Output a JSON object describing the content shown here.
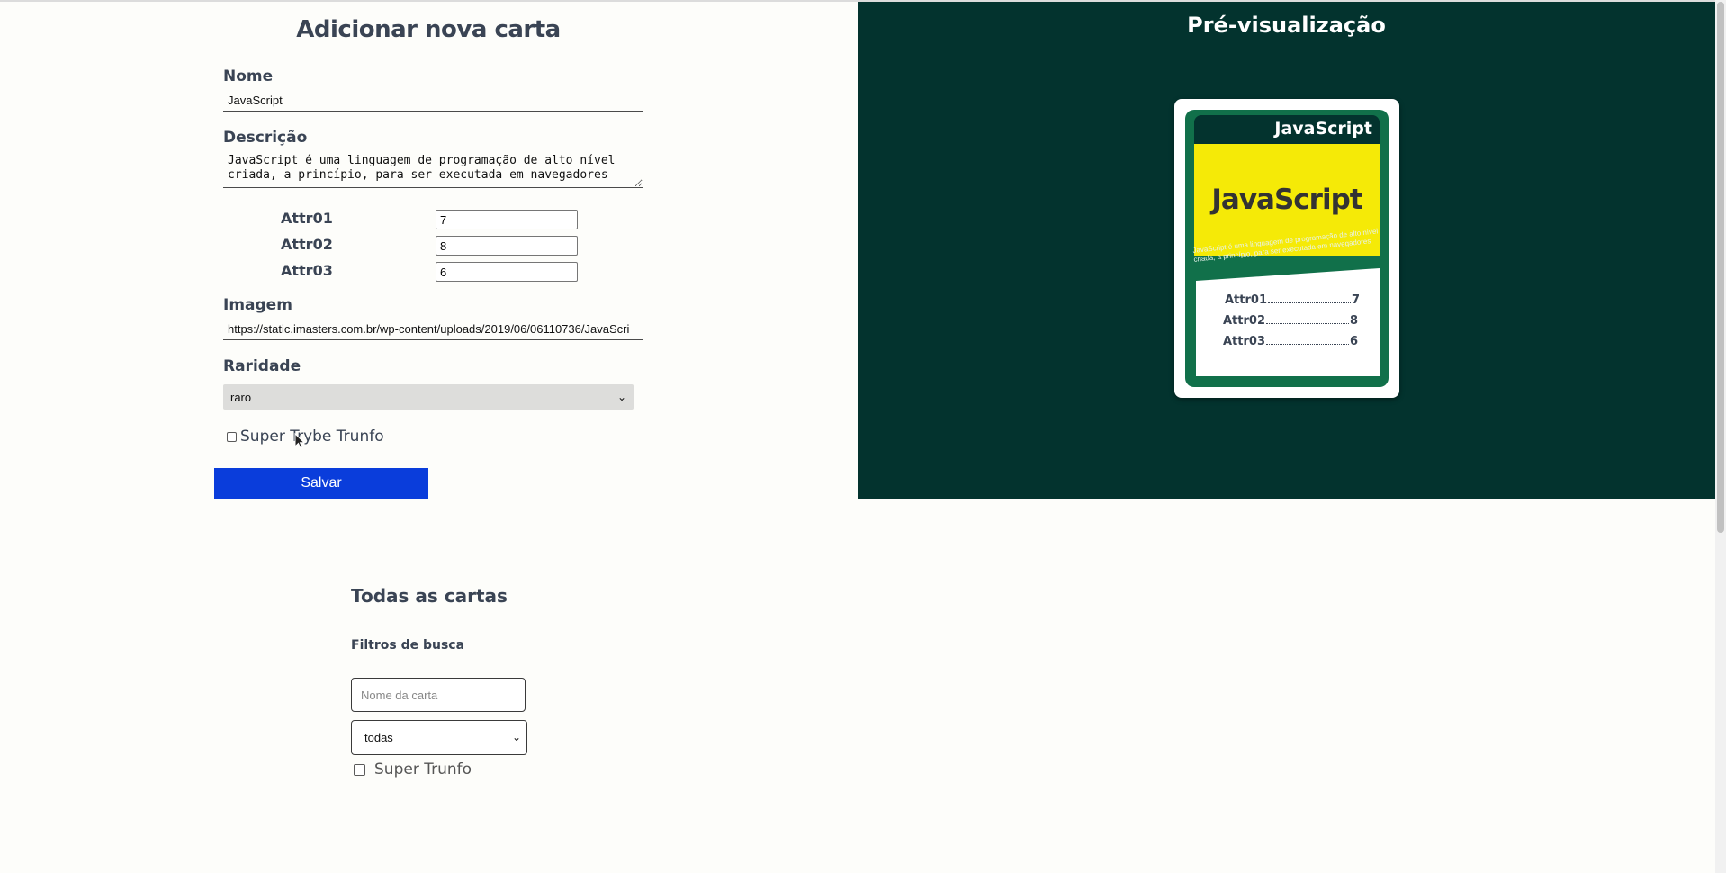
{
  "form": {
    "title": "Adicionar nova carta",
    "name_label": "Nome",
    "name_value": "JavaScript",
    "description_label": "Descrição",
    "description_value": "JavaScript é uma linguagem de programação de alto nível criada, a princípio, para ser executada em navegadores",
    "attrs": [
      {
        "label": "Attr01",
        "value": "7"
      },
      {
        "label": "Attr02",
        "value": "8"
      },
      {
        "label": "Attr03",
        "value": "6"
      }
    ],
    "image_label": "Imagem",
    "image_value": "https://static.imasters.com.br/wp-content/uploads/2019/06/06110736/JavaScri",
    "rarity_label": "Raridade",
    "rarity_value": "raro",
    "trunfo_label": "Super Trybe Trunfo",
    "save_label": "Salvar"
  },
  "preview": {
    "title": "Pré-visualização",
    "card": {
      "name": "JavaScript",
      "image_text": "JavaScript",
      "description": "JavaScript é uma linguagem de programação de alto nível criada, a princípio, para ser executada em navegadores",
      "attrs": [
        {
          "label": "Attr01",
          "value": "7"
        },
        {
          "label": "Attr02",
          "value": "8"
        },
        {
          "label": "Attr03",
          "value": "6"
        }
      ]
    }
  },
  "listing": {
    "title": "Todas as cartas",
    "filters_title": "Filtros de busca",
    "name_placeholder": "Nome da carta",
    "rarity_value": "todas",
    "trunfo_label": "Super Trunfo"
  },
  "colors": {
    "preview_bg": "#03332e",
    "card_green": "#11704a",
    "image_yellow": "#f5ea07",
    "save_button": "#0a3ddb"
  },
  "icons": [
    "chevron-down-icon",
    "cursor-icon"
  ]
}
